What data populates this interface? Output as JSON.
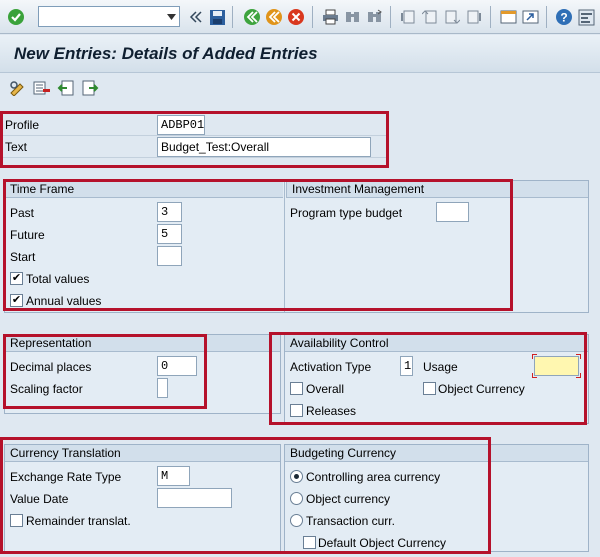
{
  "toolbar": {
    "command_field_value": "",
    "icons": [
      "enter-icon",
      "command-dropdown-icon",
      "back-arrows-icon",
      "save-icon",
      "back-icon",
      "exit-icon",
      "cancel-icon",
      "print-icon",
      "find-icon",
      "find-next-icon",
      "first-page-icon",
      "previous-page-icon",
      "next-page-icon",
      "last-page-icon",
      "create-session-icon",
      "shortcut-icon",
      "help-icon",
      "customize-layout-icon"
    ]
  },
  "title": "New Entries: Details of Added Entries",
  "app_toolbar": {
    "icons": [
      "change-display-icon",
      "delete-icon",
      "previous-entry-icon",
      "next-entry-icon"
    ]
  },
  "header": {
    "profile_label": "Profile",
    "profile_value": "ADBP01",
    "text_label": "Text",
    "text_value": "Budget_Test:Overall"
  },
  "time_frame": {
    "title": "Time Frame",
    "past_label": "Past",
    "past_value": "3",
    "future_label": "Future",
    "future_value": "5",
    "start_label": "Start",
    "start_value": "",
    "total_values_label": "Total values",
    "total_values_checked": true,
    "annual_values_label": "Annual values",
    "annual_values_checked": true
  },
  "investment": {
    "title": "Investment Management",
    "program_type_label": "Program type budget",
    "program_type_value": ""
  },
  "representation": {
    "title": "Representation",
    "decimal_label": "Decimal places",
    "decimal_value": "0",
    "scaling_label": "Scaling factor",
    "scaling_value": ""
  },
  "availability": {
    "title": "Availability Control",
    "activation_label": "Activation Type",
    "activation_value": "1",
    "usage_label": "Usage",
    "usage_value": "",
    "overall_label": "Overall",
    "object_currency_label": "Object Currency",
    "releases_label": "Releases"
  },
  "currency_translation": {
    "title": "Currency Translation",
    "exchange_label": "Exchange Rate Type",
    "exchange_value": "M",
    "value_date_label": "Value Date",
    "value_date_value": "",
    "remainder_label": "Remainder translat."
  },
  "budgeting_currency": {
    "title": "Budgeting Currency",
    "options": [
      "Controlling area currency",
      "Object currency",
      "Transaction curr."
    ],
    "selected": 0,
    "default_label": "Default Object Currency"
  },
  "colors": {
    "highlight": "#b5112b",
    "required_field": "#fff7b0"
  }
}
